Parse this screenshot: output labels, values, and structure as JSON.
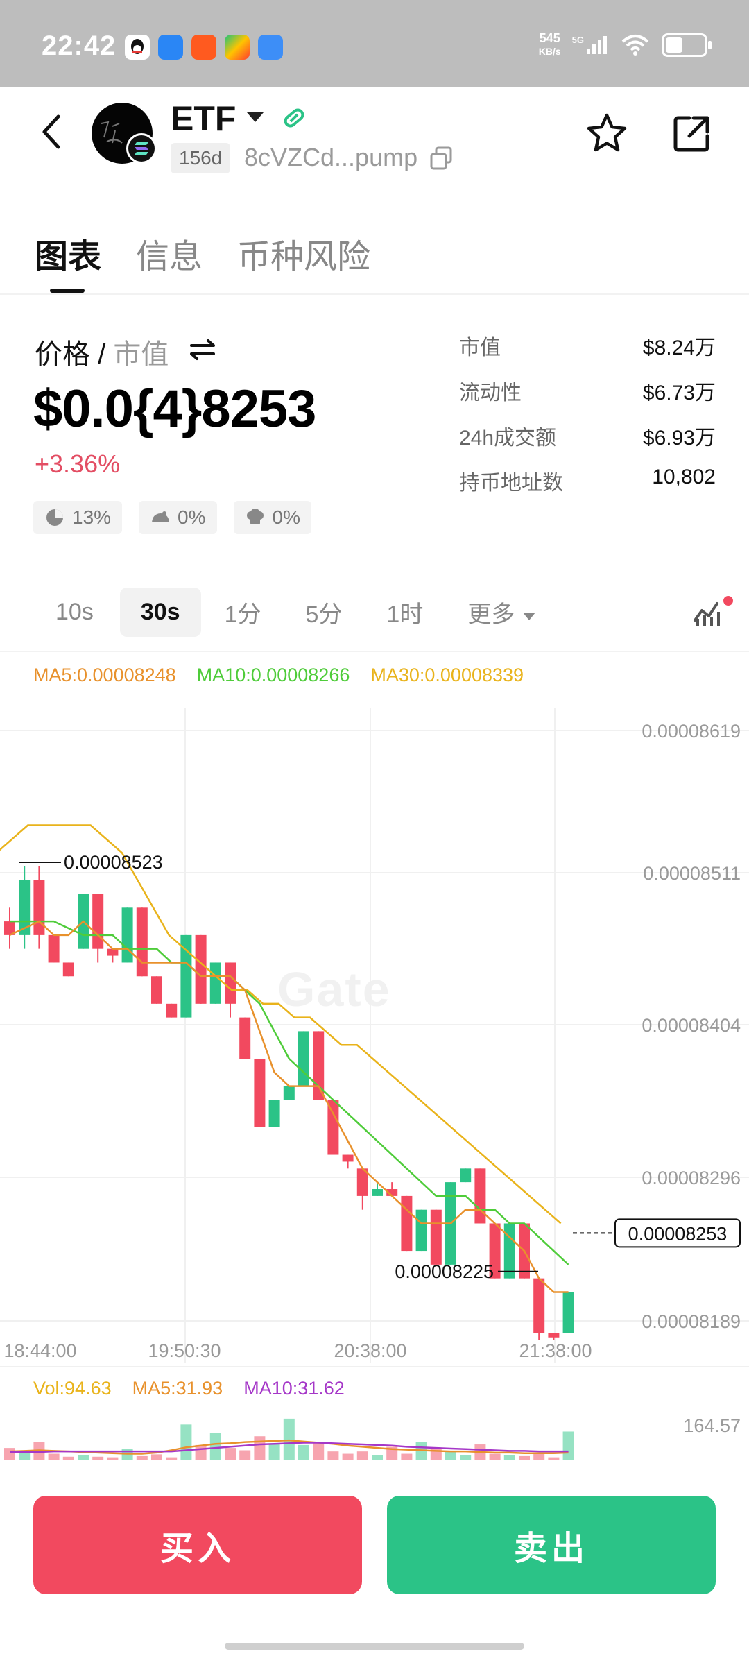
{
  "status_bar": {
    "time": "22:42",
    "net_speed_value": "545",
    "net_speed_unit": "KB/s",
    "network": "5G",
    "app_icons": [
      "qq-icon",
      "baidu-netdisk-icon",
      "kuaishou-icon",
      "colorful-app-icon",
      "cloud-app-icon"
    ]
  },
  "header": {
    "token_name": "ETF",
    "age": "156d",
    "address": "8cVZCd...pump",
    "chain": "solana"
  },
  "tabs": [
    {
      "label": "图表",
      "active": true
    },
    {
      "label": "信息",
      "active": false
    },
    {
      "label": "币种风险",
      "active": false
    }
  ],
  "price": {
    "label_primary": "价格",
    "label_sep": "/",
    "label_secondary": "市值",
    "value": "$0.0{4}8253",
    "change": "+3.36%",
    "badges": [
      {
        "icon": "pie-chart-icon",
        "value": "13%"
      },
      {
        "icon": "rat-icon",
        "value": "0%"
      },
      {
        "icon": "chef-hat-icon",
        "value": "0%"
      }
    ]
  },
  "stats": [
    {
      "key": "市值",
      "value": "$8.24万"
    },
    {
      "key": "流动性",
      "value": "$6.73万"
    },
    {
      "key": "24h成交额",
      "value": "$6.93万"
    },
    {
      "key": "持币地址数",
      "value": "10,802"
    }
  ],
  "intervals": [
    {
      "label": "10s",
      "active": false
    },
    {
      "label": "30s",
      "active": true
    },
    {
      "label": "1分",
      "active": false
    },
    {
      "label": "5分",
      "active": false
    },
    {
      "label": "1时",
      "active": false
    },
    {
      "label": "更多",
      "active": false
    }
  ],
  "ma_legend": [
    {
      "label": "MA5:0.00008248",
      "color": "#e8912c"
    },
    {
      "label": "MA10:0.00008266",
      "color": "#4fcc3a"
    },
    {
      "label": "MA30:0.00008339",
      "color": "#e9b31b"
    }
  ],
  "volume_legend": [
    {
      "label": "Vol:94.63",
      "color": "#e9b31b"
    },
    {
      "label": "MA5:31.93",
      "color": "#e8912c"
    },
    {
      "label": "MA10:31.62",
      "color": "#a537c8"
    }
  ],
  "watermark": "Gate",
  "chart_data": {
    "type": "candlestick",
    "y_ticks": [
      "0.00008619",
      "0.00008511",
      "0.00008404",
      "0.00008296",
      "0.00008189"
    ],
    "x_ticks": [
      "18:44:00",
      "19:50:30",
      "20:38:00",
      "21:38:00"
    ],
    "ylim": [
      8.189e-05,
      8.619e-05
    ],
    "high_label": "0.00008523",
    "low_label": "0.00008225",
    "last_price_label": "0.00008253",
    "volume_axis_label": "164.57",
    "up_color": "#2bc387",
    "down_color": "#f2495f",
    "candles": [
      {
        "o": 8.48e-05,
        "c": 8.47e-05,
        "h": 8.49e-05,
        "l": 8.46e-05
      },
      {
        "o": 8.47e-05,
        "c": 8.51e-05,
        "h": 8.52e-05,
        "l": 8.46e-05
      },
      {
        "o": 8.51e-05,
        "c": 8.47e-05,
        "h": 8.52e-05,
        "l": 8.46e-05
      },
      {
        "o": 8.47e-05,
        "c": 8.45e-05,
        "h": 8.47e-05,
        "l": 8.45e-05
      },
      {
        "o": 8.45e-05,
        "c": 8.44e-05,
        "h": 8.45e-05,
        "l": 8.44e-05
      },
      {
        "o": 8.46e-05,
        "c": 8.5e-05,
        "h": 8.5e-05,
        "l": 8.46e-05
      },
      {
        "o": 8.5e-05,
        "c": 8.46e-05,
        "h": 8.5e-05,
        "l": 8.45e-05
      },
      {
        "o": 8.46e-05,
        "c": 8.455e-05,
        "h": 8.46e-05,
        "l": 8.45e-05
      },
      {
        "o": 8.45e-05,
        "c": 8.49e-05,
        "h": 8.49e-05,
        "l": 8.45e-05
      },
      {
        "o": 8.49e-05,
        "c": 8.44e-05,
        "h": 8.49e-05,
        "l": 8.44e-05
      },
      {
        "o": 8.44e-05,
        "c": 8.42e-05,
        "h": 8.44e-05,
        "l": 8.42e-05
      },
      {
        "o": 8.42e-05,
        "c": 8.41e-05,
        "h": 8.42e-05,
        "l": 8.41e-05
      },
      {
        "o": 8.41e-05,
        "c": 8.47e-05,
        "h": 8.47e-05,
        "l": 8.41e-05
      },
      {
        "o": 8.47e-05,
        "c": 8.42e-05,
        "h": 8.47e-05,
        "l": 8.42e-05
      },
      {
        "o": 8.42e-05,
        "c": 8.45e-05,
        "h": 8.45e-05,
        "l": 8.42e-05
      },
      {
        "o": 8.45e-05,
        "c": 8.42e-05,
        "h": 8.45e-05,
        "l": 8.41e-05
      },
      {
        "o": 8.41e-05,
        "c": 8.38e-05,
        "h": 8.41e-05,
        "l": 8.38e-05
      },
      {
        "o": 8.38e-05,
        "c": 8.33e-05,
        "h": 8.38e-05,
        "l": 8.33e-05
      },
      {
        "o": 8.33e-05,
        "c": 8.35e-05,
        "h": 8.35e-05,
        "l": 8.33e-05
      },
      {
        "o": 8.35e-05,
        "c": 8.36e-05,
        "h": 8.36e-05,
        "l": 8.35e-05
      },
      {
        "o": 8.36e-05,
        "c": 8.4e-05,
        "h": 8.4e-05,
        "l": 8.36e-05
      },
      {
        "o": 8.4e-05,
        "c": 8.35e-05,
        "h": 8.4e-05,
        "l": 8.35e-05
      },
      {
        "o": 8.35e-05,
        "c": 8.31e-05,
        "h": 8.35e-05,
        "l": 8.31e-05
      },
      {
        "o": 8.31e-05,
        "c": 8.305e-05,
        "h": 8.31e-05,
        "l": 8.3e-05
      },
      {
        "o": 8.3e-05,
        "c": 8.28e-05,
        "h": 8.3e-05,
        "l": 8.27e-05
      },
      {
        "o": 8.28e-05,
        "c": 8.285e-05,
        "h": 8.29e-05,
        "l": 8.28e-05
      },
      {
        "o": 8.285e-05,
        "c": 8.28e-05,
        "h": 8.29e-05,
        "l": 8.28e-05
      },
      {
        "o": 8.28e-05,
        "c": 8.24e-05,
        "h": 8.28e-05,
        "l": 8.24e-05
      },
      {
        "o": 8.24e-05,
        "c": 8.27e-05,
        "h": 8.27e-05,
        "l": 8.24e-05
      },
      {
        "o": 8.27e-05,
        "c": 8.23e-05,
        "h": 8.27e-05,
        "l": 8.23e-05
      },
      {
        "o": 8.23e-05,
        "c": 8.29e-05,
        "h": 8.29e-05,
        "l": 8.23e-05
      },
      {
        "o": 8.29e-05,
        "c": 8.3e-05,
        "h": 8.3e-05,
        "l": 8.29e-05
      },
      {
        "o": 8.3e-05,
        "c": 8.26e-05,
        "h": 8.3e-05,
        "l": 8.26e-05
      },
      {
        "o": 8.26e-05,
        "c": 8.22e-05,
        "h": 8.26e-05,
        "l": 8.22e-05
      },
      {
        "o": 8.22e-05,
        "c": 8.26e-05,
        "h": 8.26e-05,
        "l": 8.22e-05
      },
      {
        "o": 8.26e-05,
        "c": 8.22e-05,
        "h": 8.26e-05,
        "l": 8.22e-05
      },
      {
        "o": 8.22e-05,
        "c": 8.18e-05,
        "h": 8.22e-05,
        "l": 8.175e-05
      },
      {
        "o": 8.18e-05,
        "c": 8.177e-05,
        "h": 8.18e-05,
        "l": 8.175e-05
      },
      {
        "o": 8.18e-05,
        "c": 8.21e-05,
        "h": 8.21e-05,
        "l": 8.18e-05
      }
    ],
    "ma5_line": [
      8.47e-05,
      8.475e-05,
      8.48e-05,
      8.47e-05,
      8.47e-05,
      8.48e-05,
      8.47e-05,
      8.46e-05,
      8.46e-05,
      8.45e-05,
      8.45e-05,
      8.45e-05,
      8.45e-05,
      8.44e-05,
      8.44e-05,
      8.44e-05,
      8.43e-05,
      8.4e-05,
      8.37e-05,
      8.36e-05,
      8.36e-05,
      8.36e-05,
      8.34e-05,
      8.32e-05,
      8.3e-05,
      8.29e-05,
      8.28e-05,
      8.27e-05,
      8.26e-05,
      8.26e-05,
      8.26e-05,
      8.27e-05,
      8.27e-05,
      8.26e-05,
      8.25e-05,
      8.24e-05,
      8.22e-05,
      8.21e-05,
      8.21e-05
    ],
    "ma10_line": [
      8.48e-05,
      8.48e-05,
      8.48e-05,
      8.48e-05,
      8.475e-05,
      8.47e-05,
      8.47e-05,
      8.47e-05,
      8.46e-05,
      8.46e-05,
      8.46e-05,
      8.45e-05,
      8.45e-05,
      8.44e-05,
      8.44e-05,
      8.44e-05,
      8.43e-05,
      8.42e-05,
      8.4e-05,
      8.38e-05,
      8.37e-05,
      8.36e-05,
      8.35e-05,
      8.34e-05,
      8.33e-05,
      8.32e-05,
      8.31e-05,
      8.3e-05,
      8.29e-05,
      8.28e-05,
      8.28e-05,
      8.28e-05,
      8.27e-05,
      8.27e-05,
      8.26e-05,
      8.26e-05,
      8.25e-05,
      8.24e-05,
      8.23e-05
    ],
    "ma30_line": [
      8.53e-05,
      8.54e-05,
      8.55e-05,
      8.55e-05,
      8.55e-05,
      8.55e-05,
      8.55e-05,
      8.54e-05,
      8.53e-05,
      8.51e-05,
      8.49e-05,
      8.47e-05,
      8.46e-05,
      8.45e-05,
      8.44e-05,
      8.43e-05,
      8.43e-05,
      8.42e-05,
      8.42e-05,
      8.41e-05,
      8.41e-05,
      8.4e-05,
      8.39e-05,
      8.39e-05,
      8.38e-05,
      8.37e-05,
      8.36e-05,
      8.35e-05,
      8.34e-05,
      8.33e-05,
      8.32e-05,
      8.31e-05,
      8.3e-05,
      8.29e-05,
      8.28e-05,
      8.27e-05,
      8.26e-05
    ],
    "volumes": [
      20,
      12,
      30,
      10,
      5,
      8,
      5,
      4,
      18,
      6,
      9,
      4,
      60,
      25,
      45,
      20,
      16,
      40,
      28,
      70,
      25,
      30,
      14,
      10,
      14,
      8,
      22,
      10,
      30,
      18,
      15,
      8,
      26,
      10,
      8,
      6,
      10,
      4,
      48
    ],
    "vol_ma5": [
      14,
      15,
      16,
      15,
      14,
      13,
      12,
      11,
      10,
      10,
      12,
      16,
      21,
      24,
      27,
      28,
      30,
      31,
      32,
      33,
      31,
      29,
      27,
      24,
      22,
      20,
      18,
      17,
      16,
      15,
      14,
      14,
      13,
      12,
      12,
      11,
      11,
      11,
      12
    ],
    "vol_ma10": [
      13,
      13,
      13,
      14,
      14,
      14,
      14,
      14,
      14,
      14,
      14,
      14,
      16,
      18,
      20,
      22,
      24,
      26,
      27,
      28,
      29,
      29,
      28,
      27,
      26,
      25,
      24,
      22,
      21,
      20,
      19,
      18,
      17,
      16,
      15,
      15,
      14,
      14,
      14
    ]
  },
  "actions": {
    "buy_label": "买入",
    "sell_label": "卖出"
  }
}
